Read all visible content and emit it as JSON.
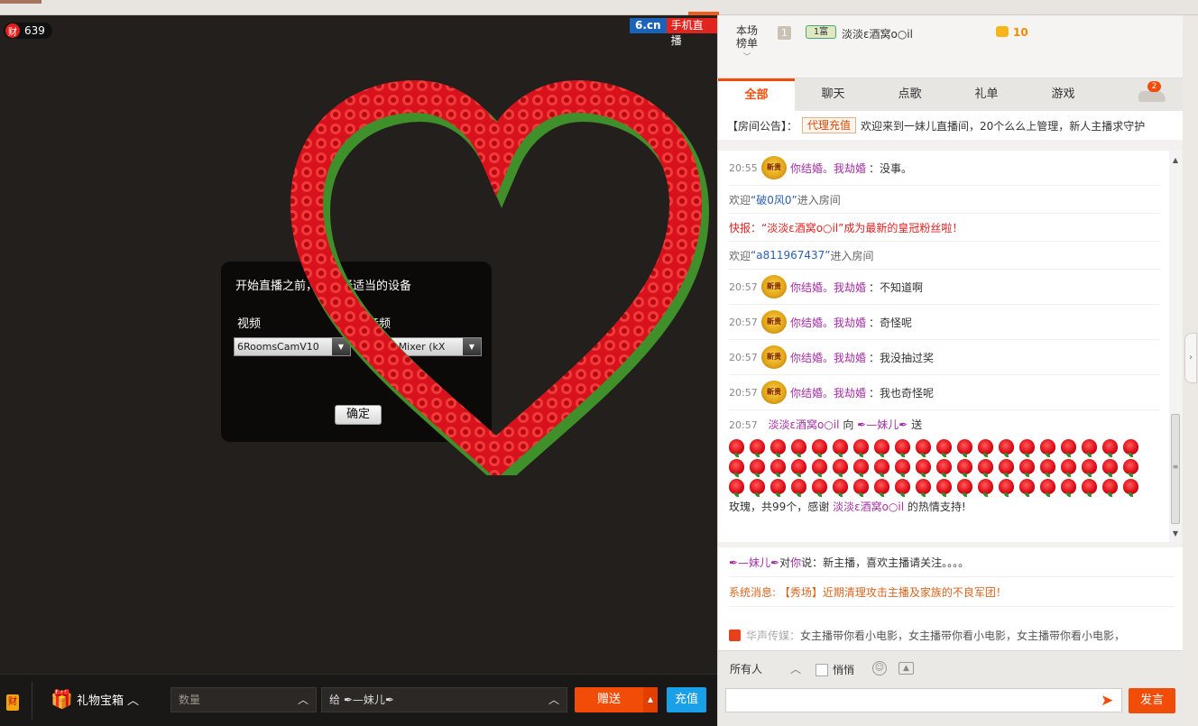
{
  "video": {
    "fortune_glyph": "财",
    "viewer_count": "639",
    "brand_site": "6.cn",
    "brand_mobile": "手机直播",
    "dialog": {
      "title": "开始直播之前，请选择适当的设备",
      "video_label": "视频",
      "audio_label": "音频",
      "video_device": "6RoomsCamV10",
      "audio_device": "Wave Mixer (kX",
      "confirm_label": "确定"
    }
  },
  "giftbar": {
    "fortune_glyph": "财",
    "giftbox_label": "礼物宝箱",
    "quantity_placeholder": "数量",
    "recipient": "给 ✒—妹儿✒",
    "send_label": "赠送",
    "recharge_label": "充值"
  },
  "rank": {
    "label": "本场榜单",
    "rank_no": "1",
    "badge": "1富",
    "name": "淡淡ε酒窝o○il",
    "coins": "10"
  },
  "tabs": [
    {
      "label": "全部",
      "active": true
    },
    {
      "label": "聊天"
    },
    {
      "label": "点歌"
    },
    {
      "label": "礼单"
    },
    {
      "label": "游戏"
    }
  ],
  "car_badge": "2",
  "notice": {
    "prefix": "【房间公告】：",
    "tag": "代理充值",
    "text": "欢迎来到一妹儿直播间，20个么么上管理，新人主播求守护"
  },
  "chat": {
    "vip_glyph": "新贵",
    "messages": [
      {
        "time": "20:55",
        "user": "你结婚。我劫婚",
        "text": "：没事。"
      },
      {
        "time": "20:57",
        "user": "你结婚。我劫婚",
        "text": "：不知道啊"
      },
      {
        "time": "20:57",
        "user": "你结婚。我劫婚",
        "text": "：奇怪呢"
      },
      {
        "time": "20:57",
        "user": "你结婚。我劫婚",
        "text": "：我没抽过奖"
      },
      {
        "time": "20:57",
        "user": "你结婚。我劫婚",
        "text": "：我也奇怪呢"
      }
    ],
    "welcome1": {
      "pre": "欢迎 ",
      "name": "“破0风0”",
      "post": "进入房间"
    },
    "flash": "快报：“淡淡ε酒窝o○il”成为最新的皇冠粉丝啦！",
    "welcome2": {
      "pre": "欢迎 ",
      "name": "“a811967437”",
      "post": "进入房间"
    },
    "gift": {
      "time": "20:57",
      "from": "淡淡ε酒窝o○il",
      "to_word": " 向 ",
      "to": "✒—妹儿✒",
      "send_word": " 送 ",
      "summary_pre": " 玫瑰，共99个，感谢 ",
      "summary_user": "淡淡ε酒窝o○il",
      "summary_post": " 的热情支持!",
      "rose_count": 99
    }
  },
  "private": {
    "from": "✒—妹儿✒",
    "mid": " 对 ",
    "you": "你",
    "said": " 说：",
    "text": "新主播，喜欢主播请关注。。。。",
    "system": "系统消息: 【秀场】近期清理攻击主播及家族的不良军团！"
  },
  "ticker": {
    "source": "华声传媒：",
    "text": "女主播带你看小电影，女主播带你看小电影，女主播带你看小电影，"
  },
  "input": {
    "target": "所有人",
    "quiet_label": "悄悄",
    "speak_label": "发言"
  },
  "colors": {
    "accent": "#f24d08",
    "recharge": "#1aa0e8",
    "username": "#a52da5",
    "flash": "#e02020"
  }
}
